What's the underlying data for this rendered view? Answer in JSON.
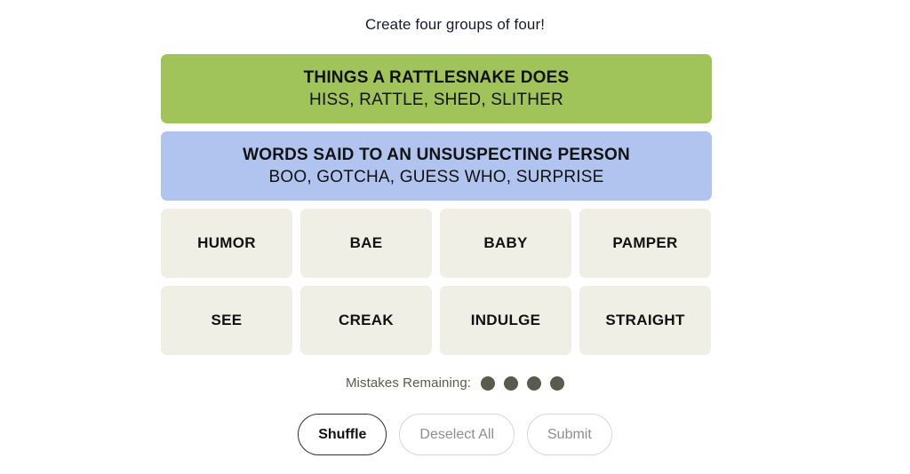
{
  "header": {
    "title": "Create four groups of four!"
  },
  "board": {
    "solved_groups": [
      {
        "category": "THINGS A RATTLESNAKE DOES",
        "words_line": "HISS, RATTLE, SHED, SLITHER",
        "color": "#a0c35a",
        "difficulty": "green"
      },
      {
        "category": "WORDS SAID TO AN UNSUSPECTING PERSON",
        "words_line": "BOO, GOTCHA, GUESS WHO, SURPRISE",
        "color": "#b0c4ef",
        "difficulty": "blue"
      }
    ],
    "tile_rows": [
      [
        {
          "word": "HUMOR"
        },
        {
          "word": "BAE"
        },
        {
          "word": "BABY"
        },
        {
          "word": "PAMPER"
        }
      ],
      [
        {
          "word": "SEE"
        },
        {
          "word": "CREAK"
        },
        {
          "word": "INDULGE"
        },
        {
          "word": "STRAIGHT"
        }
      ]
    ],
    "tile_color": "#efefe6"
  },
  "mistakes": {
    "label": "Mistakes Remaining:",
    "remaining": 4,
    "dot_color": "#5a5a4e"
  },
  "controls": {
    "buttons": [
      {
        "label": "Shuffle",
        "state": "enabled"
      },
      {
        "label": "Deselect All",
        "state": "disabled"
      },
      {
        "label": "Submit",
        "state": "disabled"
      }
    ]
  }
}
